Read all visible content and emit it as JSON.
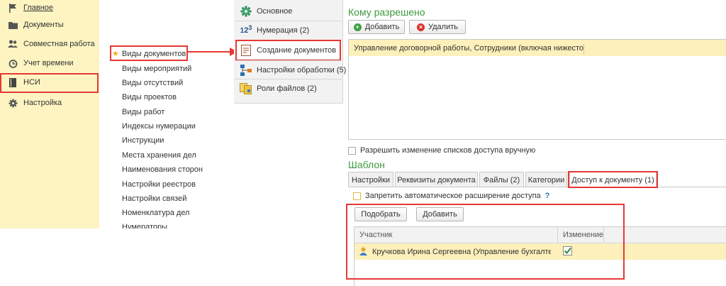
{
  "nav": {
    "items": [
      {
        "label": "Главное",
        "icon": "flag-icon"
      },
      {
        "label": "Документы",
        "icon": "folder-icon"
      },
      {
        "label": "Совместная работа",
        "icon": "users-icon"
      },
      {
        "label": "Учет времени",
        "icon": "clock-icon"
      },
      {
        "label": "НСИ",
        "icon": "book-icon"
      },
      {
        "label": "Настройка",
        "icon": "gear-icon"
      }
    ]
  },
  "reference": {
    "items": [
      "Виды документов",
      "Виды мероприятий",
      "Виды отсутствий",
      "Виды проектов",
      "Виды работ",
      "Индексы нумерации",
      "Инструкции",
      "Места хранения дел",
      "Наименования сторон",
      "Настройки реестров",
      "Настройки связей",
      "Номенклатура дел",
      "Нумераторы"
    ]
  },
  "settings": {
    "items": [
      {
        "label": "Основное",
        "icon": "gear-icon"
      },
      {
        "label": "Нумерация (2)",
        "icon": "numbering-icon"
      },
      {
        "label": "Создание документов",
        "icon": "document-icon"
      },
      {
        "label": "Настройки обработки (5)",
        "icon": "workflow-icon"
      },
      {
        "label": "Роли файлов (2)",
        "icon": "file-roles-icon"
      }
    ]
  },
  "allowed": {
    "title": "Кому разрешено",
    "add_label": "Добавить",
    "delete_label": "Удалить",
    "row": "Управление договорной работы, Сотрудники (включая нижестоя..."
  },
  "manual_access_label": "Разрешить изменение списков доступа вручную",
  "template": {
    "title": "Шаблон",
    "tabs": [
      "Настройки",
      "Реквизиты документа",
      "Файлы (2)",
      "Категории",
      "Доступ к документу (1)"
    ],
    "forbid_label": "Запретить автоматическое расширение доступа",
    "help": "?",
    "pick_label": "Подобрать",
    "add_label": "Добавить",
    "columns": [
      "Участник",
      "Изменение"
    ],
    "participant": "Кручкова Ирина Сергеевна (Управление бухгалтер..."
  },
  "colors": {
    "nav_bg": "#fdf4c2",
    "highlight_row": "#fdf0bb",
    "accent_green": "#3e9a3e",
    "annotation_red": "#e53935"
  }
}
